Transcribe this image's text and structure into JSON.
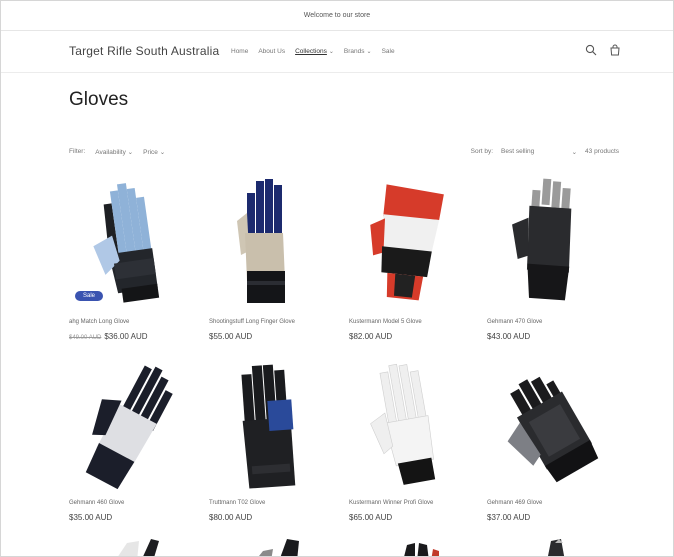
{
  "announcement": "Welcome to our store",
  "brand": "Target Rifle South Australia",
  "nav": [
    {
      "label": "Home"
    },
    {
      "label": "About Us"
    },
    {
      "label": "Collections"
    },
    {
      "label": "Brands"
    },
    {
      "label": "Sale"
    }
  ],
  "page_title": "Gloves",
  "filters": {
    "label": "Filter:",
    "availability": "Availability",
    "price": "Price"
  },
  "sort": {
    "label": "Sort by:",
    "value": "Best selling",
    "count": "43 products"
  },
  "products": [
    {
      "name": "ahg Match Long Glove",
      "old_price": "$49.00 AUD",
      "price": "$36.00 AUD",
      "badge": "Sale"
    },
    {
      "name": "Shootingstuff Long Finger Glove",
      "price": "$55.00 AUD"
    },
    {
      "name": "Kustermann Model 5 Glove",
      "price": "$82.00 AUD"
    },
    {
      "name": "Gehmann 470 Glove",
      "price": "$43.00 AUD"
    },
    {
      "name": "Gehmann 460 Glove",
      "price": "$35.00 AUD"
    },
    {
      "name": "Truttmann T02 Glove",
      "price": "$80.00 AUD"
    },
    {
      "name": "Kustermann Winner Profi Glove",
      "price": "$65.00 AUD"
    },
    {
      "name": "Gehmann 469 Glove",
      "price": "$37.00 AUD"
    }
  ],
  "icons": [
    "search-icon",
    "cart-icon",
    "chevron-down-icon"
  ]
}
